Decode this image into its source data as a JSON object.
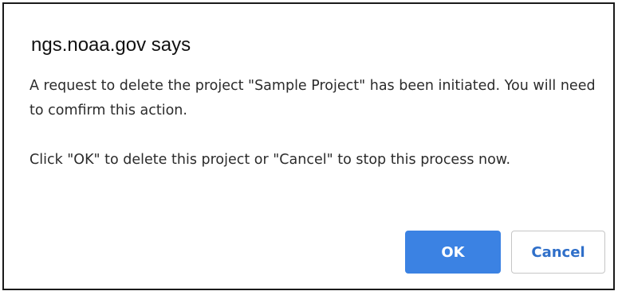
{
  "dialog": {
    "title": "ngs.noaa.gov says",
    "message_line1": "A request to delete the project \"Sample Project\" has been initiated. You will need to comfirm this action.",
    "message_line2": "Click \"OK\" to delete this project or \"Cancel\" to stop this process now.",
    "ok_label": "OK",
    "cancel_label": "Cancel"
  },
  "colors": {
    "ok_button_bg": "#3b82e3",
    "cancel_button_text": "#2f6fc9",
    "border": "#1a1a1a"
  }
}
